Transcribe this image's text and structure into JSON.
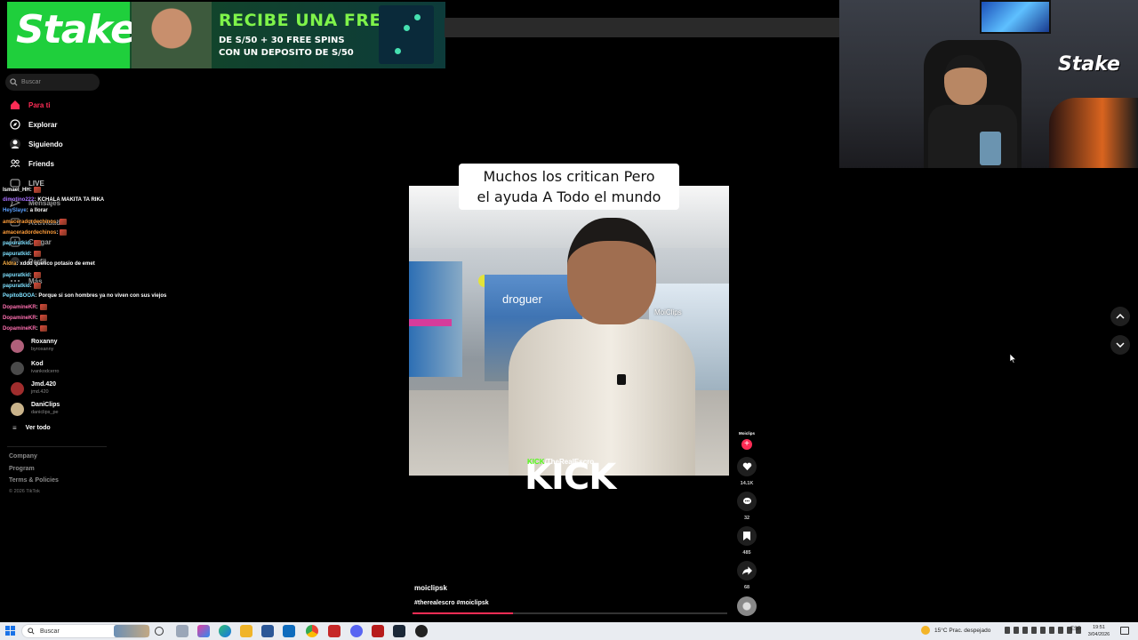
{
  "banner": {
    "brand": "Stake",
    "headline": "RECIBE UNA FREEBET",
    "line1": "DE S/50 + 30 FREE SPINS",
    "line2": "CON UN DEPOSITO DE S/50"
  },
  "webcam": {
    "overlay_logo": "Stake"
  },
  "search": {
    "placeholder": "Buscar",
    "icon": "search-icon"
  },
  "nav": [
    {
      "label": "Para ti",
      "icon": "home-icon",
      "active": true
    },
    {
      "label": "Explorar",
      "icon": "compass-icon"
    },
    {
      "label": "Siguiendo",
      "icon": "following-icon"
    },
    {
      "label": "Friends",
      "icon": "friends-icon"
    },
    {
      "label": "LIVE",
      "icon": "live-icon"
    },
    {
      "label": "Mensajes",
      "icon": "messages-icon"
    },
    {
      "label": "Actividad",
      "icon": "activity-icon"
    },
    {
      "label": "Cargar",
      "icon": "upload-icon"
    },
    {
      "label": "Perfil",
      "icon": "profile-icon"
    },
    {
      "label": "Más",
      "icon": "more-icon"
    }
  ],
  "following": [
    {
      "name": "Roxanny",
      "handle": "byroxanny",
      "color": "#b0607a"
    },
    {
      "name": "Kod",
      "handle": "ivankodcerro",
      "color": "#4a4a4a"
    },
    {
      "name": "Jmd.420",
      "handle": "jmd.420",
      "color": "#a02d2d"
    },
    {
      "name": "DaniClips",
      "handle": "daniclips_pe",
      "color": "#c9b38a"
    }
  ],
  "ver_todo": "Ver todo",
  "footer": {
    "links": [
      "Company",
      "Program",
      "Terms & Policies"
    ],
    "copyright": "© 2026 TikTok"
  },
  "chat": [
    {
      "user": "Ismael_HH",
      "color": "#ffffff",
      "msg": "",
      "emote": true
    },
    {
      "user": "dimotino222",
      "color": "#a970ff",
      "msg": "KCHALA MAKITA TA RIKA",
      "emote": false
    },
    {
      "user": "HeySlaye",
      "color": "#5aa0ff",
      "msg": "a llorar",
      "emote": false
    },
    {
      "user": "amaceradordechinos",
      "color": "#ff9d3a",
      "msg": "",
      "emote": true
    },
    {
      "user": "amaceradordechinos",
      "color": "#ff9d3a",
      "msg": "",
      "emote": true
    },
    {
      "user": "papuratkid",
      "color": "#7ee0ff",
      "msg": "",
      "emote": true
    },
    {
      "user": "papuratkid",
      "color": "#7ee0ff",
      "msg": "",
      "emote": true
    },
    {
      "user": "Aldra",
      "color": "#ffb347",
      "msg": "xddd quelico potasio de emet",
      "emote": false
    },
    {
      "user": "papuratkid",
      "color": "#7ee0ff",
      "msg": "",
      "emote": true
    },
    {
      "user": "papuratkid",
      "color": "#7ee0ff",
      "msg": "",
      "emote": true
    },
    {
      "user": "PepitoBOOA",
      "color": "#7ee0ff",
      "msg": "Porque si son hombres ya no viven con sus viejos",
      "emote": false
    },
    {
      "user": "DopamineKR",
      "color": "#ff6fb0",
      "msg": "",
      "emote": true
    },
    {
      "user": "DopamineKR",
      "color": "#ff6fb0",
      "msg": "",
      "emote": true
    },
    {
      "user": "DopamineKR",
      "color": "#ff6fb0",
      "msg": "",
      "emote": true
    }
  ],
  "video": {
    "caption_line1": "Muchos los critican Pero",
    "caption_line2": "el ayuda A Todo el mundo",
    "store_sign": "droguer",
    "store_sign_right": "MoiClips",
    "kick_prefix": "KICK",
    "kick_handle": "/TheRealEscro",
    "kick_logo": "KICK",
    "author": "moiclipsk",
    "tags": "#therealescro #moiclipsk",
    "progress": 0.32
  },
  "actions": {
    "author_short": "Moiclips",
    "likes": "14.1K",
    "comments": "32",
    "saves": "485",
    "shares": "68"
  },
  "taskbar": {
    "search": "Buscar",
    "weather": "15°C  Prac. despejado",
    "lang": "ESP",
    "time": "19:51",
    "date": "3/04/2026"
  }
}
